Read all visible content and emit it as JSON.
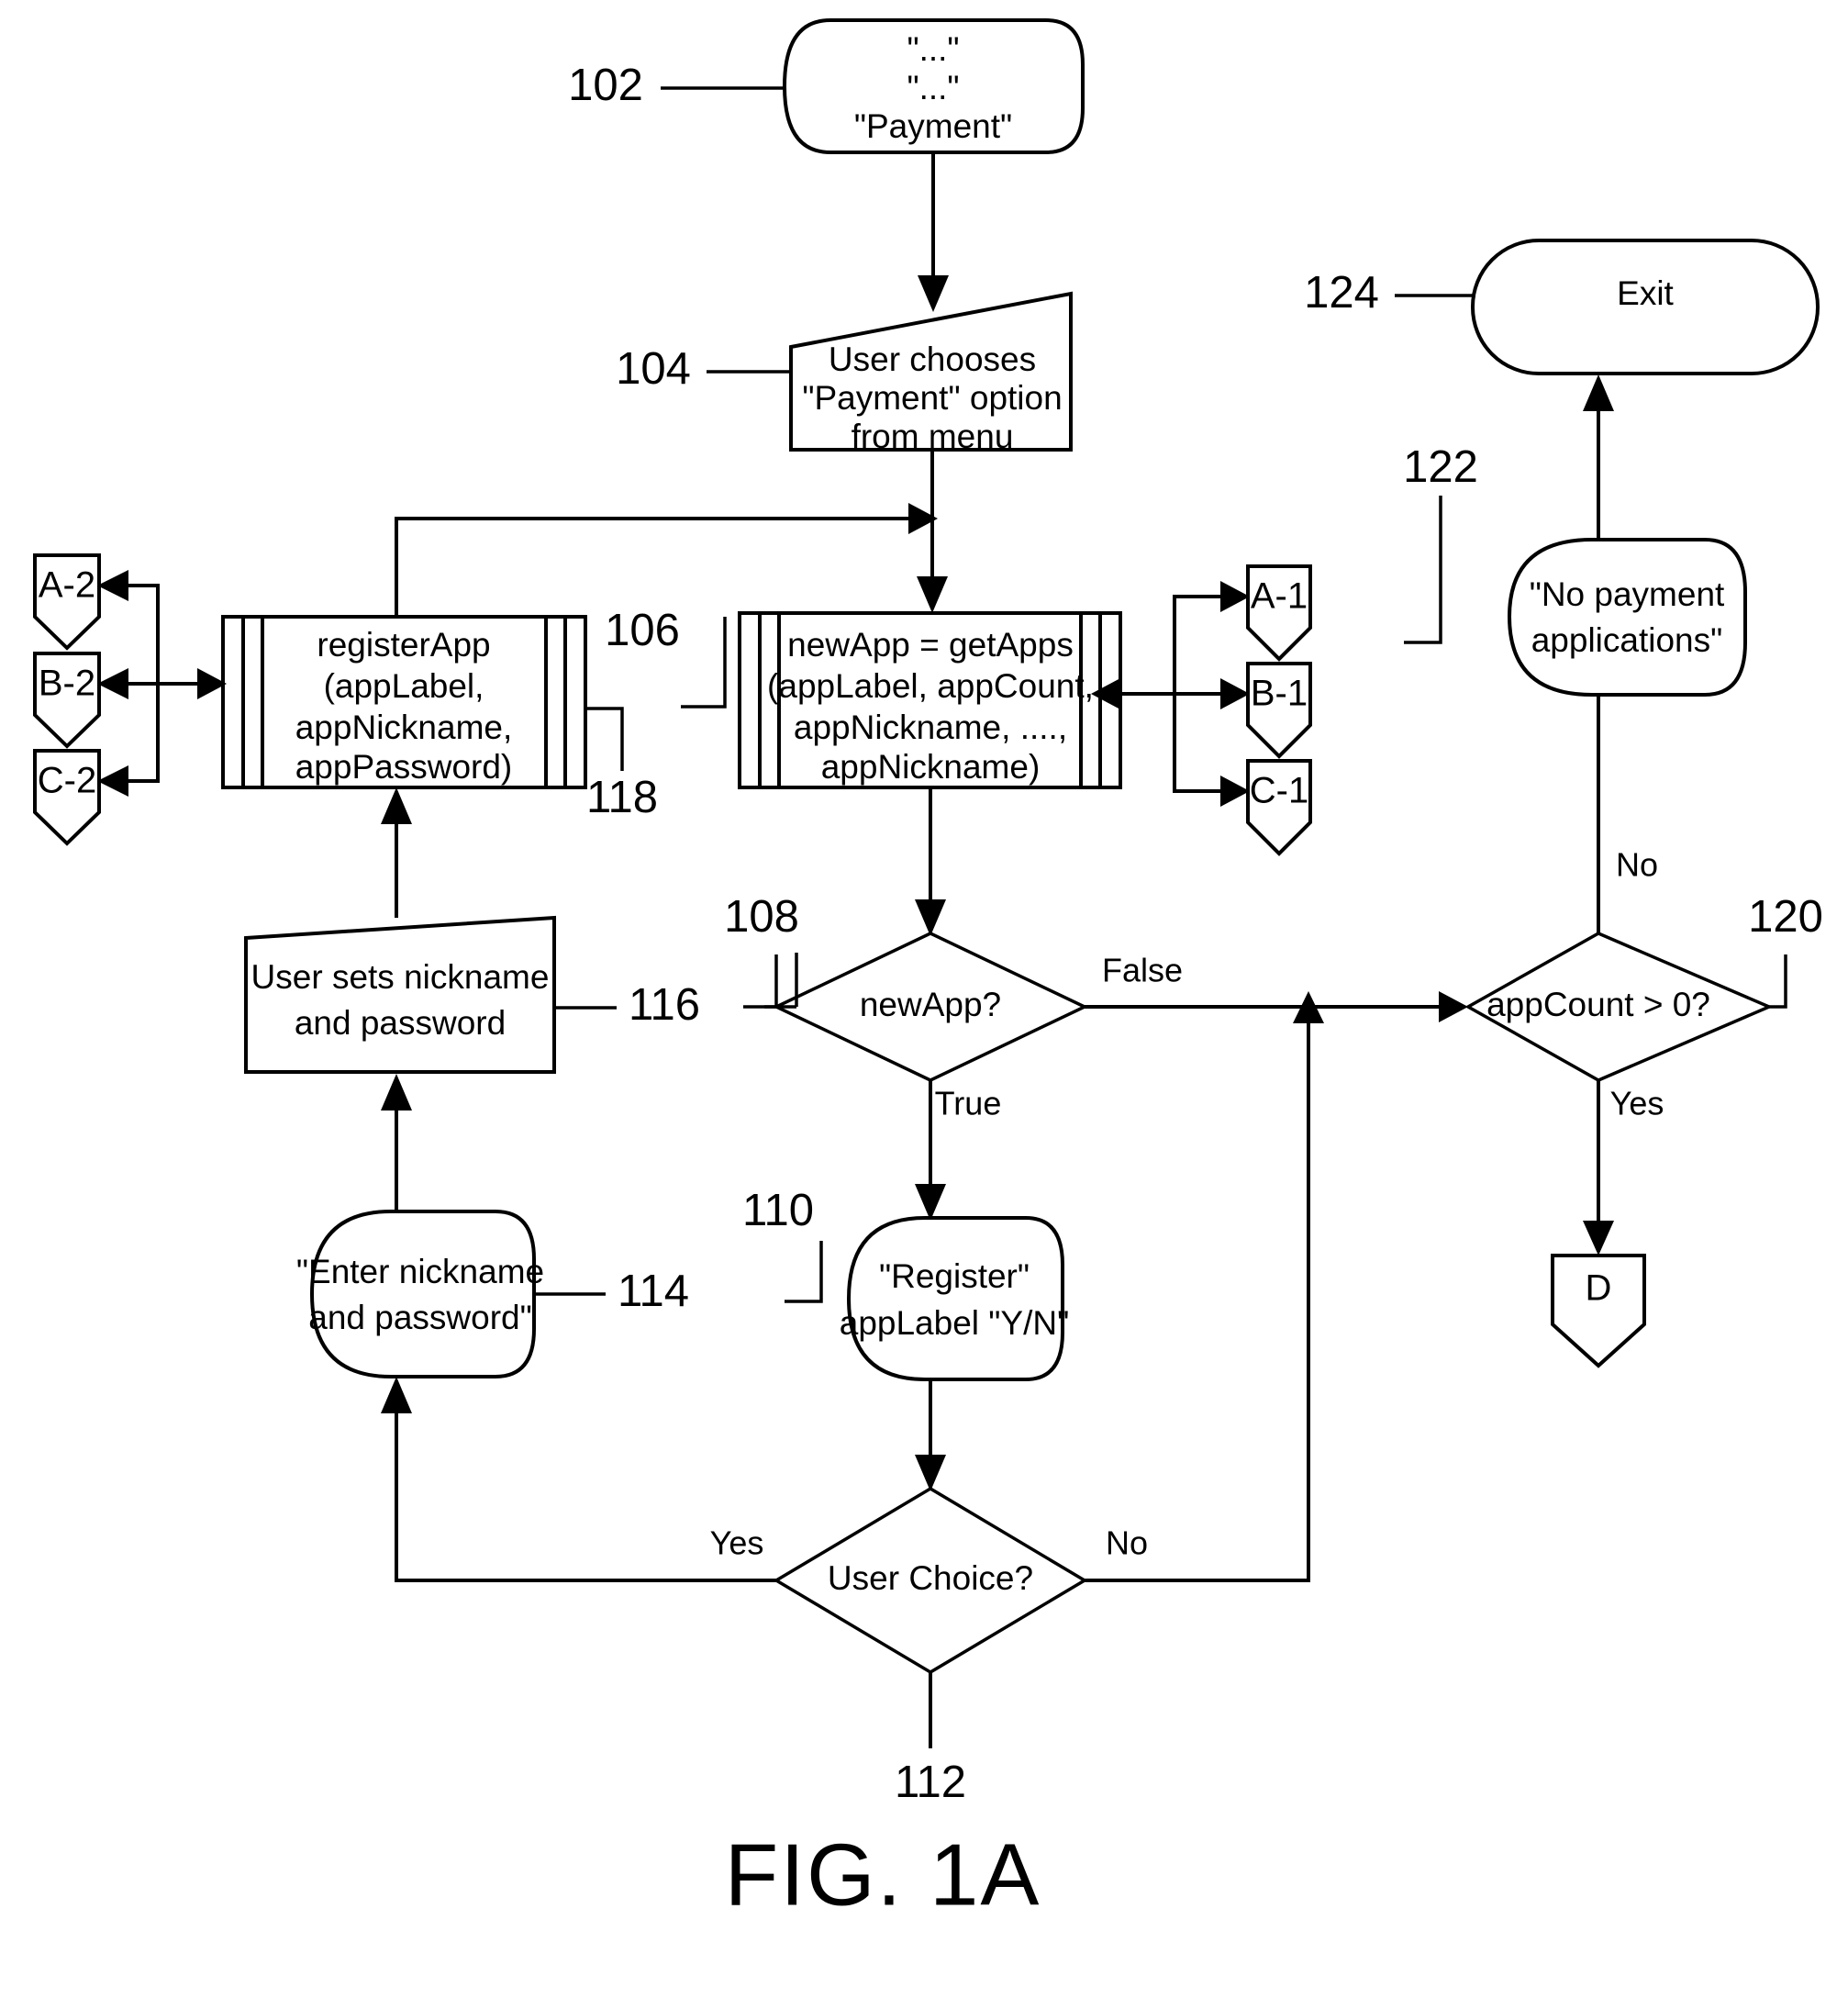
{
  "figure": {
    "caption": "FIG. 1A"
  },
  "nodes": {
    "n102": {
      "ref": "102",
      "shape": "display",
      "lines": [
        "\"...\"",
        "\"...\"",
        "\"Payment\""
      ]
    },
    "n104": {
      "ref": "104",
      "shape": "trapezoid-manual-input",
      "lines": [
        "User chooses",
        "\"Payment\" option",
        "from menu"
      ]
    },
    "n106": {
      "ref": "106",
      "shape": "predefined-process",
      "lines": [
        "newApp = getApps",
        "(appLabel, appCount,",
        "appNickname, ....,",
        "appNickname)"
      ]
    },
    "n108": {
      "ref": "108",
      "shape": "decision",
      "lines": [
        "newApp?"
      ]
    },
    "n110": {
      "ref": "110",
      "shape": "display",
      "lines": [
        "\"Register\"",
        "appLabel \"Y/N\""
      ]
    },
    "n112": {
      "ref": "112",
      "shape": "decision",
      "lines": [
        "User Choice?"
      ]
    },
    "n114": {
      "ref": "114",
      "shape": "display",
      "lines": [
        "\"Enter nickname",
        "and password\""
      ]
    },
    "n116": {
      "ref": "116",
      "shape": "trapezoid-manual-input",
      "lines": [
        "User sets nickname",
        "and password"
      ]
    },
    "n118": {
      "ref": "118",
      "shape": "predefined-process",
      "lines": [
        "registerApp",
        "(appLabel,",
        "appNickname,",
        "appPassword)"
      ]
    },
    "n120": {
      "ref": "120",
      "shape": "decision",
      "lines": [
        "appCount > 0?"
      ]
    },
    "n122": {
      "ref": "122",
      "shape": "display",
      "lines": [
        "\"No payment",
        "applications\""
      ]
    },
    "n124": {
      "ref": "124",
      "shape": "terminator",
      "lines": [
        "Exit"
      ]
    }
  },
  "connectors": {
    "a1": {
      "label": "A-1"
    },
    "b1": {
      "label": "B-1"
    },
    "c1": {
      "label": "C-1"
    },
    "a2": {
      "label": "A-2"
    },
    "b2": {
      "label": "B-2"
    },
    "c2": {
      "label": "C-2"
    },
    "d": {
      "label": "D"
    }
  },
  "edge_labels": {
    "e108_false": "False",
    "e108_true": "True",
    "e112_yes": "Yes",
    "e112_no": "No",
    "e120_no": "No",
    "e120_yes": "Yes"
  },
  "colors": {
    "ink": "#000000",
    "paper": "#ffffff"
  }
}
